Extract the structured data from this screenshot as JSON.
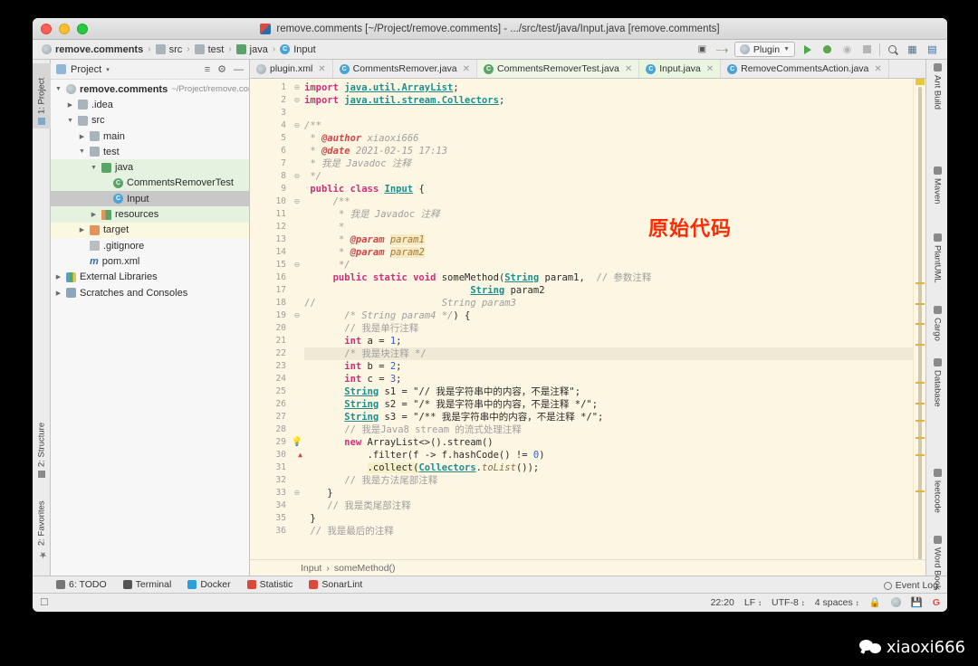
{
  "window": {
    "title": "remove.comments [~/Project/remove.comments] - .../src/test/java/Input.java [remove.comments]"
  },
  "breadcrumb": {
    "items": [
      {
        "label": "remove.comments",
        "icon": "module-icon"
      },
      {
        "label": "src",
        "icon": "folder-icon"
      },
      {
        "label": "test",
        "icon": "folder-icon"
      },
      {
        "label": "java",
        "icon": "source-folder-icon"
      },
      {
        "label": "Input",
        "icon": "class-icon"
      }
    ],
    "separator": "›"
  },
  "toolbar": {
    "run_config_label": "Plugin",
    "buttons": [
      {
        "name": "project-structure-icon",
        "glyph": "▣"
      },
      {
        "name": "build-hammer-icon",
        "glyph": "⚒"
      },
      {
        "name": "run-icon",
        "glyph": "▶"
      },
      {
        "name": "debug-icon",
        "glyph": "●"
      },
      {
        "name": "run-coverage-icon",
        "glyph": "◔"
      },
      {
        "name": "stop-icon",
        "glyph": "■"
      },
      {
        "name": "search-everywhere-icon",
        "glyph": "⌕"
      },
      {
        "name": "project-settings-icon",
        "glyph": "▦"
      },
      {
        "name": "search-icon",
        "glyph": "⌕"
      }
    ]
  },
  "left_strip": {
    "tabs": [
      {
        "label": "1: Project",
        "selected": true
      },
      {
        "label": "2: Structure",
        "selected": false
      },
      {
        "label": "2: Favorites",
        "selected": false
      }
    ]
  },
  "project_panel": {
    "title": "Project",
    "dropdown_glyph": "▾",
    "actions": [
      "collapse-all-icon",
      "settings-gear-icon",
      "hide-icon"
    ],
    "tree": [
      {
        "depth": 0,
        "arrow": "▼",
        "label": "remove.comments",
        "suffix": "~/Project/remove.cor",
        "icon": "module-icon",
        "bold": true,
        "state": "none"
      },
      {
        "depth": 1,
        "arrow": "▶",
        "label": ".idea",
        "icon": "folder-icon",
        "state": "none"
      },
      {
        "depth": 1,
        "arrow": "▼",
        "label": "src",
        "icon": "folder-icon",
        "state": "none"
      },
      {
        "depth": 2,
        "arrow": "▶",
        "label": "main",
        "icon": "folder-icon",
        "state": "none"
      },
      {
        "depth": 2,
        "arrow": "▼",
        "label": "test",
        "icon": "folder-icon",
        "state": "none"
      },
      {
        "depth": 3,
        "arrow": "▼",
        "label": "java",
        "icon": "source-folder-icon",
        "state": "green"
      },
      {
        "depth": 4,
        "arrow": "",
        "label": "CommentsRemoverTest",
        "icon": "test-class-icon",
        "state": "green"
      },
      {
        "depth": 4,
        "arrow": "",
        "label": "Input",
        "icon": "class-icon",
        "state": "selected"
      },
      {
        "depth": 3,
        "arrow": "▶",
        "label": "resources",
        "icon": "resources-folder-icon",
        "state": "green"
      },
      {
        "depth": 2,
        "arrow": "▶",
        "label": "target",
        "icon": "excluded-folder-icon",
        "state": "yellow"
      },
      {
        "depth": 2,
        "arrow": "",
        "label": ".gitignore",
        "icon": "file-icon",
        "state": "none"
      },
      {
        "depth": 2,
        "arrow": "",
        "label": "pom.xml",
        "icon": "maven-icon",
        "state": "none"
      },
      {
        "depth": 0,
        "arrow": "▶",
        "label": "External Libraries",
        "icon": "libraries-icon",
        "state": "none"
      },
      {
        "depth": 0,
        "arrow": "▶",
        "label": "Scratches and Consoles",
        "icon": "scratches-icon",
        "state": "none"
      }
    ]
  },
  "editor_tabs": [
    {
      "label": "plugin.xml",
      "icon": "xml-icon",
      "active": false,
      "tint": false
    },
    {
      "label": "CommentsRemover.java",
      "icon": "class-icon",
      "active": false,
      "tint": false
    },
    {
      "label": "CommentsRemoverTest.java",
      "icon": "test-class-icon",
      "active": false,
      "tint": true
    },
    {
      "label": "Input.java",
      "icon": "class-icon",
      "active": true,
      "tint": false
    },
    {
      "label": "RemoveCommentsAction.java",
      "icon": "class-icon",
      "active": false,
      "tint": false
    }
  ],
  "annotation": {
    "text": "原始代码",
    "color": "#ff2a00"
  },
  "code": {
    "current_line": 22,
    "lines": [
      {
        "n": 1,
        "fold": "⊖",
        "html": "<span class=\"kw\">import</span> <span class=\"cls\">java.util.ArrayList</span>;"
      },
      {
        "n": 2,
        "fold": "⊖",
        "html": "<span class=\"kw\">import</span> <span class=\"cls\">java.util.stream.Collectors</span>;"
      },
      {
        "n": 3,
        "fold": "",
        "html": ""
      },
      {
        "n": 4,
        "fold": "⊖",
        "html": "<span class=\"doc\">/**</span>"
      },
      {
        "n": 5,
        "fold": "",
        "html": " <span class=\"doc\">* </span><span class=\"tagd\">@author</span><span class=\"doc\"> xiaoxi666</span>"
      },
      {
        "n": 6,
        "fold": "",
        "html": " <span class=\"doc\">* </span><span class=\"tagd\">@date</span><span class=\"doc\"> 2021-02-15 17:13</span>"
      },
      {
        "n": 7,
        "fold": "",
        "html": " <span class=\"doc\">* 我是 Javadoc 注释</span>"
      },
      {
        "n": 8,
        "fold": "⊖",
        "html": " <span class=\"doc\">*/</span>"
      },
      {
        "n": 9,
        "fold": "",
        "html": " <span class=\"kw\">public class</span> <span class=\"cls\">Input</span> {"
      },
      {
        "n": 10,
        "fold": "⊖",
        "html": "     <span class=\"doc\">/**</span>"
      },
      {
        "n": 11,
        "fold": "",
        "html": "      <span class=\"doc\">* 我是 Javadoc 注释</span>"
      },
      {
        "n": 12,
        "fold": "",
        "html": "      <span class=\"doc\">*</span>"
      },
      {
        "n": 13,
        "fold": "",
        "html": "      <span class=\"doc\">* </span><span class=\"tagd\">@param</span> <span class=\"param\">param1</span>"
      },
      {
        "n": 14,
        "fold": "",
        "html": "      <span class=\"doc\">* </span><span class=\"tagd\">@param</span> <span class=\"param\">param2</span>"
      },
      {
        "n": 15,
        "fold": "⊖",
        "html": "      <span class=\"doc\">*/</span>"
      },
      {
        "n": 16,
        "fold": "",
        "html": "     <span class=\"kw\">public static void</span> someMethod(<span class=\"cls\">String</span> param1,  <span class=\"cmtd\">// 参数注释</span>"
      },
      {
        "n": 17,
        "fold": "",
        "html": "                             <span class=\"cls\">String</span> param2"
      },
      {
        "n": 18,
        "fold": "",
        "html": "<span class=\"cmtd\">//</span>                      <span class=\"cmt\">String param3</span>"
      },
      {
        "n": 19,
        "fold": "⊖",
        "html": "       <span class=\"cmt\">/* String param4 */</span>) {"
      },
      {
        "n": 20,
        "fold": "",
        "html": "       <span class=\"cmtd\">// 我是单行注释</span>"
      },
      {
        "n": 21,
        "fold": "",
        "html": "       <span class=\"kw\">int</span> a = <span class=\"num\">1</span>;"
      },
      {
        "n": 22,
        "fold": "",
        "html": "       <span class=\"cmtd\">/* 我是块注释 */</span>"
      },
      {
        "n": 23,
        "fold": "",
        "html": "       <span class=\"kw\">int</span> b = <span class=\"num\">2</span>;"
      },
      {
        "n": 24,
        "fold": "",
        "html": "       <span class=\"kw\">int</span> c = <span class=\"num\">3</span>;"
      },
      {
        "n": 25,
        "fold": "",
        "html": "       <span class=\"cls\">String</span> s1 = <span class=\"str\">\"// 我是字符串中的内容，不是注释\"</span>;"
      },
      {
        "n": 26,
        "fold": "",
        "html": "       <span class=\"cls\">String</span> s2 = <span class=\"str\">\"/* 我是字符串中的内容，不是注释 */\"</span>;"
      },
      {
        "n": 27,
        "fold": "",
        "html": "       <span class=\"cls\">String</span> s3 = <span class=\"str\">\"/** 我是字符串中的内容，不是注释 */\"</span>;"
      },
      {
        "n": 28,
        "fold": "",
        "html": "       <span class=\"cmtd\">// 我是Java8 stream 的流式处理注释</span>"
      },
      {
        "n": 29,
        "fold": "",
        "html": "       <span class=\"kw\">new</span> ArrayList&lt;&gt;().stream()"
      },
      {
        "n": 30,
        "fold": "",
        "html": "           .filter(f -&gt; f.hashCode() != <span class=\"num\">0</span>)"
      },
      {
        "n": 31,
        "fold": "",
        "html": "           <span class=\"hlw\">.collect(</span><span class=\"cls\">Collectors</span>.<span class=\"lit\">toList</span>());"
      },
      {
        "n": 32,
        "fold": "",
        "html": "       <span class=\"cmtd\">// 我是方法尾部注释</span>"
      },
      {
        "n": 33,
        "fold": "⊖",
        "html": "    }"
      },
      {
        "n": 34,
        "fold": "",
        "html": "    <span class=\"cmtd\">// 我是类尾部注释</span>"
      },
      {
        "n": 35,
        "fold": "",
        "html": " }"
      },
      {
        "n": 36,
        "fold": "",
        "html": " <span class=\"cmtd\">// 我是最后的注释</span>"
      }
    ]
  },
  "editor_breadcrumb": {
    "class": "Input",
    "separator": "›",
    "method": "someMethod()"
  },
  "right_strip": {
    "tabs": [
      {
        "label": "Ant Build"
      },
      {
        "label": "Maven"
      },
      {
        "label": "PlantUML"
      },
      {
        "label": "Cargo"
      },
      {
        "label": "Database"
      },
      {
        "label": "leetcode"
      },
      {
        "label": "Word Book"
      }
    ]
  },
  "tool_windows": [
    {
      "label": "6: TODO",
      "icon": "todo-icon"
    },
    {
      "label": "Terminal",
      "icon": "terminal-icon"
    },
    {
      "label": "Docker",
      "icon": "docker-icon"
    },
    {
      "label": "Statistic",
      "icon": "statistic-icon"
    },
    {
      "label": "SonarLint",
      "icon": "sonarlint-icon"
    }
  ],
  "status_bar": {
    "event_log": "Event Log",
    "time": "22:20",
    "line_separator": "LF",
    "encoding": "UTF-8",
    "indent": "4 spaces",
    "icons": [
      "lock-icon",
      "branch-icon",
      "save-icon",
      "google-icon"
    ],
    "chevron": "↕"
  },
  "watermark": {
    "text": "xiaoxi666",
    "icon": "wechat-icon"
  }
}
